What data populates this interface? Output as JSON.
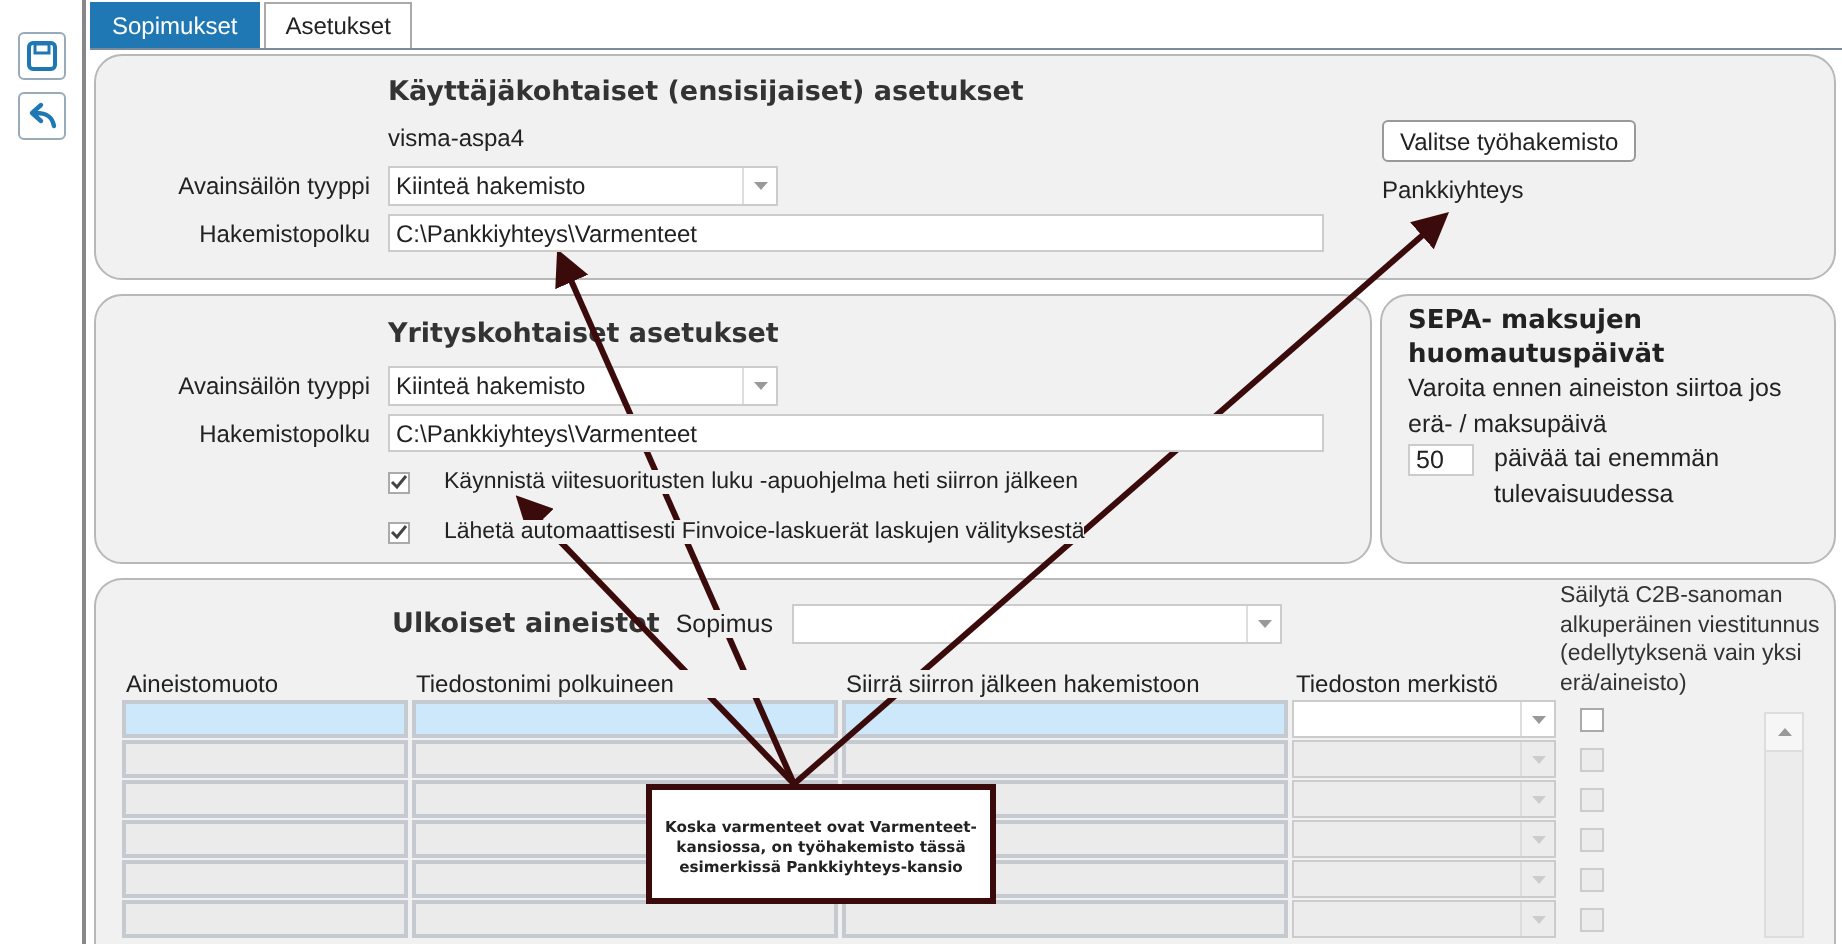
{
  "toolbar": [
    {
      "kind": "save"
    },
    {
      "kind": "undo"
    }
  ],
  "tabs": [
    {
      "label": "Sopimukset",
      "selected": true
    },
    {
      "label": "Asetukset",
      "selected": false
    }
  ],
  "user_settings": {
    "title": "Käyttäjäkohtaiset (ensisijaiset) asetukset",
    "user": "visma-aspa4",
    "key_store_type": {
      "label": "Avainsäilön tyyppi",
      "value": "Kiinteä hakemisto"
    },
    "path": {
      "label": "Hakemistopolku",
      "value": "C:\\Pankkiyhteys\\Varmenteet"
    },
    "button": "Valitse työhakemisto",
    "work_dir": "Pankkiyhteys"
  },
  "company_settings": {
    "title": "Yrityskohtaiset asetukset",
    "key_store_type": {
      "label": "Avainsäilön tyyppi",
      "value": "Kiinteä hakemisto"
    },
    "path": {
      "label": "Hakemistopolku",
      "value": "C:\\Pankkiyhteys\\Varmenteet"
    },
    "options": [
      {
        "label": "Käynnistä viitesuoritusten luku -apuohjelma heti siirron jälkeen",
        "checked": true
      },
      {
        "label": "Lähetä automaattisesti Finvoice-laskuerät laskujen välityksestä",
        "checked": true
      }
    ]
  },
  "sepa": {
    "title": "SEPA- maksujen huomautuspäivät",
    "text": "Varoita ennen aineiston siirtoa jos erä- / maksupäivä",
    "days": "50",
    "after": "päivää tai enemmän tulevaisuudessa"
  },
  "external": {
    "title": "Ulkoiset aineistot",
    "contract_label": "Sopimus",
    "columns": [
      "Aineistomuoto",
      "Tiedostonimi polkuineen",
      "Siirrä siirron jälkeen hakemistoon",
      "Tiedoston merkistö",
      "Säilytä C2B-sanoman alkuperäinen viestitunnus (edellytyksenä vain yksi erä/aineisto)"
    ],
    "rows": [
      {
        "selected": true,
        "disabled": false,
        "checked": false
      },
      {
        "selected": false,
        "disabled": true,
        "checked": false
      },
      {
        "selected": false,
        "disabled": true,
        "checked": false
      },
      {
        "selected": false,
        "disabled": true,
        "checked": false
      },
      {
        "selected": false,
        "disabled": true,
        "checked": false
      },
      {
        "selected": false,
        "disabled": true,
        "checked": false
      }
    ]
  },
  "callout": {
    "text": "Koska varmenteet ovat Varmenteet-kansiossa, on työhakemisto tässä esimerkissä Pankkiyhteys-kansio"
  }
}
